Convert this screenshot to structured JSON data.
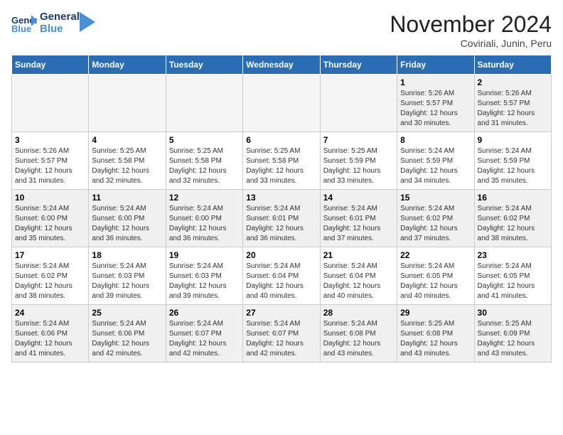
{
  "header": {
    "logo": {
      "line1": "General",
      "line2": "Blue"
    },
    "title": "November 2024",
    "subtitle": "Coviriali, Junin, Peru"
  },
  "weekdays": [
    "Sunday",
    "Monday",
    "Tuesday",
    "Wednesday",
    "Thursday",
    "Friday",
    "Saturday"
  ],
  "weeks": [
    [
      {
        "day": "",
        "info": ""
      },
      {
        "day": "",
        "info": ""
      },
      {
        "day": "",
        "info": ""
      },
      {
        "day": "",
        "info": ""
      },
      {
        "day": "",
        "info": ""
      },
      {
        "day": "1",
        "info": "Sunrise: 5:26 AM\nSunset: 5:57 PM\nDaylight: 12 hours\nand 30 minutes."
      },
      {
        "day": "2",
        "info": "Sunrise: 5:26 AM\nSunset: 5:57 PM\nDaylight: 12 hours\nand 31 minutes."
      }
    ],
    [
      {
        "day": "3",
        "info": "Sunrise: 5:26 AM\nSunset: 5:57 PM\nDaylight: 12 hours\nand 31 minutes."
      },
      {
        "day": "4",
        "info": "Sunrise: 5:25 AM\nSunset: 5:58 PM\nDaylight: 12 hours\nand 32 minutes."
      },
      {
        "day": "5",
        "info": "Sunrise: 5:25 AM\nSunset: 5:58 PM\nDaylight: 12 hours\nand 32 minutes."
      },
      {
        "day": "6",
        "info": "Sunrise: 5:25 AM\nSunset: 5:58 PM\nDaylight: 12 hours\nand 33 minutes."
      },
      {
        "day": "7",
        "info": "Sunrise: 5:25 AM\nSunset: 5:59 PM\nDaylight: 12 hours\nand 33 minutes."
      },
      {
        "day": "8",
        "info": "Sunrise: 5:24 AM\nSunset: 5:59 PM\nDaylight: 12 hours\nand 34 minutes."
      },
      {
        "day": "9",
        "info": "Sunrise: 5:24 AM\nSunset: 5:59 PM\nDaylight: 12 hours\nand 35 minutes."
      }
    ],
    [
      {
        "day": "10",
        "info": "Sunrise: 5:24 AM\nSunset: 6:00 PM\nDaylight: 12 hours\nand 35 minutes."
      },
      {
        "day": "11",
        "info": "Sunrise: 5:24 AM\nSunset: 6:00 PM\nDaylight: 12 hours\nand 36 minutes."
      },
      {
        "day": "12",
        "info": "Sunrise: 5:24 AM\nSunset: 6:00 PM\nDaylight: 12 hours\nand 36 minutes."
      },
      {
        "day": "13",
        "info": "Sunrise: 5:24 AM\nSunset: 6:01 PM\nDaylight: 12 hours\nand 36 minutes."
      },
      {
        "day": "14",
        "info": "Sunrise: 5:24 AM\nSunset: 6:01 PM\nDaylight: 12 hours\nand 37 minutes."
      },
      {
        "day": "15",
        "info": "Sunrise: 5:24 AM\nSunset: 6:02 PM\nDaylight: 12 hours\nand 37 minutes."
      },
      {
        "day": "16",
        "info": "Sunrise: 5:24 AM\nSunset: 6:02 PM\nDaylight: 12 hours\nand 38 minutes."
      }
    ],
    [
      {
        "day": "17",
        "info": "Sunrise: 5:24 AM\nSunset: 6:02 PM\nDaylight: 12 hours\nand 38 minutes."
      },
      {
        "day": "18",
        "info": "Sunrise: 5:24 AM\nSunset: 6:03 PM\nDaylight: 12 hours\nand 39 minutes."
      },
      {
        "day": "19",
        "info": "Sunrise: 5:24 AM\nSunset: 6:03 PM\nDaylight: 12 hours\nand 39 minutes."
      },
      {
        "day": "20",
        "info": "Sunrise: 5:24 AM\nSunset: 6:04 PM\nDaylight: 12 hours\nand 40 minutes."
      },
      {
        "day": "21",
        "info": "Sunrise: 5:24 AM\nSunset: 6:04 PM\nDaylight: 12 hours\nand 40 minutes."
      },
      {
        "day": "22",
        "info": "Sunrise: 5:24 AM\nSunset: 6:05 PM\nDaylight: 12 hours\nand 40 minutes."
      },
      {
        "day": "23",
        "info": "Sunrise: 5:24 AM\nSunset: 6:05 PM\nDaylight: 12 hours\nand 41 minutes."
      }
    ],
    [
      {
        "day": "24",
        "info": "Sunrise: 5:24 AM\nSunset: 6:06 PM\nDaylight: 12 hours\nand 41 minutes."
      },
      {
        "day": "25",
        "info": "Sunrise: 5:24 AM\nSunset: 6:06 PM\nDaylight: 12 hours\nand 42 minutes."
      },
      {
        "day": "26",
        "info": "Sunrise: 5:24 AM\nSunset: 6:07 PM\nDaylight: 12 hours\nand 42 minutes."
      },
      {
        "day": "27",
        "info": "Sunrise: 5:24 AM\nSunset: 6:07 PM\nDaylight: 12 hours\nand 42 minutes."
      },
      {
        "day": "28",
        "info": "Sunrise: 5:24 AM\nSunset: 6:08 PM\nDaylight: 12 hours\nand 43 minutes."
      },
      {
        "day": "29",
        "info": "Sunrise: 5:25 AM\nSunset: 6:08 PM\nDaylight: 12 hours\nand 43 minutes."
      },
      {
        "day": "30",
        "info": "Sunrise: 5:25 AM\nSunset: 6:09 PM\nDaylight: 12 hours\nand 43 minutes."
      }
    ]
  ]
}
